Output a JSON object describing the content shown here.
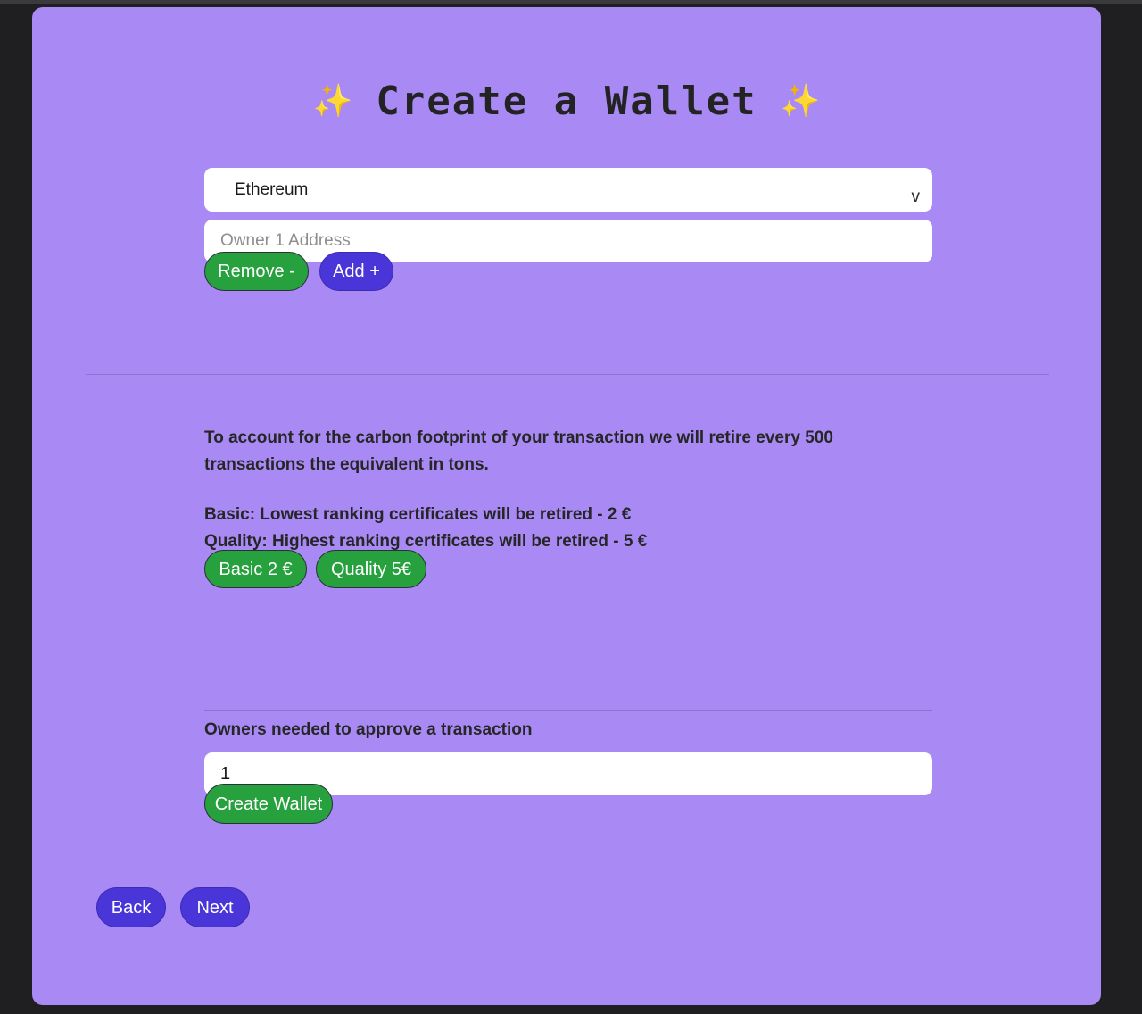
{
  "app": {
    "title": "Create a Wallet",
    "sparkle_icon": "✨",
    "card_bg": "#a98af5",
    "accent_green": "#27a03e",
    "accent_blue": "#4a35d8"
  },
  "form": {
    "chain_select": {
      "value": "Ethereum",
      "chevron": "v",
      "options": [
        "Ethereum"
      ]
    },
    "owner_address": {
      "value": "",
      "placeholder": "Owner 1 Address"
    },
    "remove_owner_label": "Remove -",
    "add_owner_label": "Add +"
  },
  "carbon": {
    "intro": "To account for the carbon footprint of your transaction we will retire every 500 transactions the equivalent in tons.",
    "basic_line": "Basic: Lowest ranking certificates will be retired - 2 €",
    "quality_line": "Quality: Highest ranking certificates will be retired - 5 €",
    "basic_button_label": "Basic 2 €",
    "quality_button_label": "Quality 5€"
  },
  "approvals": {
    "label": "Owners needed to approve a transaction",
    "value": "1",
    "placeholder": "",
    "create_wallet_label": "Create Wallet"
  },
  "navigation": {
    "back_label": "Back",
    "next_label": "Next"
  }
}
